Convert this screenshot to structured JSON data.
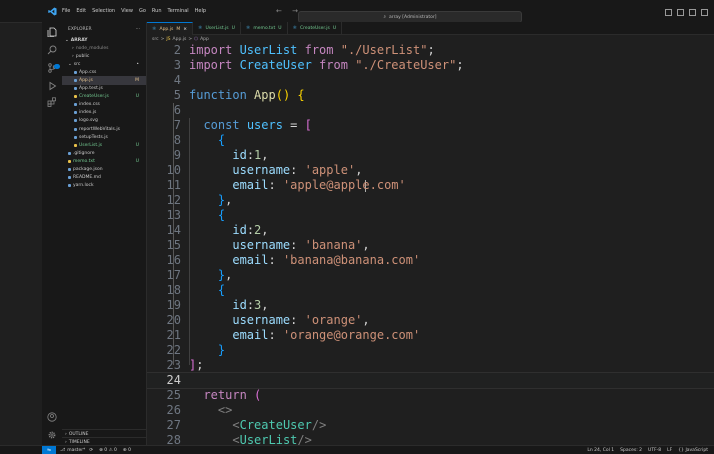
{
  "titlebar": {
    "menu": [
      "File",
      "Edit",
      "Selection",
      "View",
      "Go",
      "Run",
      "Terminal",
      "Help"
    ],
    "nav_arrows": "← →",
    "search_text": "array [Administrator]"
  },
  "explorer": {
    "title": "EXPLORER",
    "more": "···",
    "project": "ARRAY",
    "items": [
      {
        "label": "node_modules",
        "mark": "",
        "color": "#8b8b8b"
      },
      {
        "label": "public",
        "mark": "",
        "color": "#cccccc"
      },
      {
        "label": "src",
        "mark": "•",
        "color": "#cccccc"
      },
      {
        "label": "App.css",
        "mark": "",
        "color": "#cccccc"
      },
      {
        "label": "App.js",
        "mark": "M",
        "color": "#e2c08d"
      },
      {
        "label": "App.test.js",
        "mark": "",
        "color": "#cccccc"
      },
      {
        "label": "CreateUser.js",
        "mark": "U",
        "color": "#73c991"
      },
      {
        "label": "index.css",
        "mark": "",
        "color": "#cccccc"
      },
      {
        "label": "index.js",
        "mark": "",
        "color": "#cccccc"
      },
      {
        "label": "logo.svg",
        "mark": "",
        "color": "#cccccc"
      },
      {
        "label": "reportWebVitals.js",
        "mark": "",
        "color": "#cccccc"
      },
      {
        "label": "setupTests.js",
        "mark": "",
        "color": "#cccccc"
      },
      {
        "label": "UserList.js",
        "mark": "U",
        "color": "#73c991"
      },
      {
        "label": ".gitignore",
        "mark": "",
        "color": "#cccccc"
      },
      {
        "label": "memo.txt",
        "mark": "U",
        "color": "#73c991"
      },
      {
        "label": "package.json",
        "mark": "",
        "color": "#cccccc"
      },
      {
        "label": "README.md",
        "mark": "",
        "color": "#cccccc"
      },
      {
        "label": "yarn.lock",
        "mark": "",
        "color": "#cccccc"
      }
    ],
    "outline": "OUTLINE",
    "timeline": "TIMELINE"
  },
  "tabs": [
    {
      "label": "App.js",
      "mark": "M",
      "active": true,
      "close": "×"
    },
    {
      "label": "UserList.js",
      "mark": "U",
      "active": false
    },
    {
      "label": "memo.txt",
      "mark": "U",
      "active": false
    },
    {
      "label": "CreateUser.js",
      "mark": "U",
      "active": false
    }
  ],
  "breadcrumb": {
    "src": "src",
    "sep": ">",
    "file": "App.js",
    "symbol": "App"
  },
  "code_lines": [
    {
      "n": "2",
      "tokens": [
        [
          "imp",
          "import "
        ],
        [
          "var",
          "UserList"
        ],
        [
          "imp",
          " from "
        ],
        [
          "str",
          "\"./UserList\""
        ],
        [
          "pl",
          ";"
        ]
      ]
    },
    {
      "n": "3",
      "tokens": [
        [
          "imp",
          "import "
        ],
        [
          "var",
          "CreateUser"
        ],
        [
          "imp",
          " from "
        ],
        [
          "str",
          "\"./CreateUser\""
        ],
        [
          "pl",
          ";"
        ]
      ]
    },
    {
      "n": "4",
      "tokens": []
    },
    {
      "n": "5",
      "tokens": [
        [
          "kw",
          "function "
        ],
        [
          "fn",
          "App"
        ],
        [
          "p1",
          "()"
        ],
        [
          "pl",
          " "
        ],
        [
          "p1",
          "{"
        ]
      ]
    },
    {
      "n": "6",
      "tokens": []
    },
    {
      "n": "7",
      "tokens": [
        [
          "pl",
          "  "
        ],
        [
          "kw",
          "const "
        ],
        [
          "var",
          "users"
        ],
        [
          "pl",
          " = "
        ],
        [
          "p2",
          "["
        ]
      ]
    },
    {
      "n": "8",
      "tokens": [
        [
          "pl",
          "    "
        ],
        [
          "p3",
          "{"
        ]
      ]
    },
    {
      "n": "9",
      "tokens": [
        [
          "pl",
          "      "
        ],
        [
          "prop",
          "id"
        ],
        [
          "pl",
          ":"
        ],
        [
          "num",
          "1"
        ],
        [
          "pl",
          ","
        ]
      ]
    },
    {
      "n": "10",
      "tokens": [
        [
          "pl",
          "      "
        ],
        [
          "prop",
          "username"
        ],
        [
          "pl",
          ": "
        ],
        [
          "str",
          "'apple'"
        ],
        [
          "pl",
          ","
        ]
      ]
    },
    {
      "n": "11",
      "tokens": [
        [
          "pl",
          "      "
        ],
        [
          "prop",
          "email"
        ],
        [
          "pl",
          ": "
        ],
        [
          "str",
          "'apple@apple.com'"
        ]
      ]
    },
    {
      "n": "12",
      "tokens": [
        [
          "pl",
          "    "
        ],
        [
          "p3",
          "}"
        ],
        [
          "pl",
          ","
        ]
      ]
    },
    {
      "n": "13",
      "tokens": [
        [
          "pl",
          "    "
        ],
        [
          "p3",
          "{"
        ]
      ]
    },
    {
      "n": "14",
      "tokens": [
        [
          "pl",
          "      "
        ],
        [
          "prop",
          "id"
        ],
        [
          "pl",
          ":"
        ],
        [
          "num",
          "2"
        ],
        [
          "pl",
          ","
        ]
      ]
    },
    {
      "n": "15",
      "tokens": [
        [
          "pl",
          "      "
        ],
        [
          "prop",
          "username"
        ],
        [
          "pl",
          ": "
        ],
        [
          "str",
          "'banana'"
        ],
        [
          "pl",
          ","
        ]
      ]
    },
    {
      "n": "16",
      "tokens": [
        [
          "pl",
          "      "
        ],
        [
          "prop",
          "email"
        ],
        [
          "pl",
          ": "
        ],
        [
          "str",
          "'banana@banana.com'"
        ]
      ]
    },
    {
      "n": "17",
      "tokens": [
        [
          "pl",
          "    "
        ],
        [
          "p3",
          "}"
        ],
        [
          "pl",
          ","
        ]
      ]
    },
    {
      "n": "18",
      "tokens": [
        [
          "pl",
          "    "
        ],
        [
          "p3",
          "{"
        ]
      ]
    },
    {
      "n": "19",
      "tokens": [
        [
          "pl",
          "      "
        ],
        [
          "prop",
          "id"
        ],
        [
          "pl",
          ":"
        ],
        [
          "num",
          "3"
        ],
        [
          "pl",
          ","
        ]
      ]
    },
    {
      "n": "20",
      "tokens": [
        [
          "pl",
          "      "
        ],
        [
          "prop",
          "username"
        ],
        [
          "pl",
          ": "
        ],
        [
          "str",
          "'orange'"
        ],
        [
          "pl",
          ","
        ]
      ]
    },
    {
      "n": "21",
      "tokens": [
        [
          "pl",
          "      "
        ],
        [
          "prop",
          "email"
        ],
        [
          "pl",
          ": "
        ],
        [
          "str",
          "'orange@orange.com'"
        ]
      ]
    },
    {
      "n": "22",
      "tokens": [
        [
          "pl",
          "    "
        ],
        [
          "p3",
          "}"
        ]
      ]
    },
    {
      "n": "23",
      "tokens": [
        [
          "p2",
          "]"
        ],
        [
          "pl",
          ";"
        ]
      ]
    },
    {
      "n": "24",
      "tokens": [],
      "current": true
    },
    {
      "n": "25",
      "tokens": [
        [
          "pl",
          "  "
        ],
        [
          "imp",
          "return "
        ],
        [
          "p2",
          "("
        ]
      ]
    },
    {
      "n": "26",
      "tokens": [
        [
          "pl",
          "    "
        ],
        [
          "br",
          "<>"
        ]
      ]
    },
    {
      "n": "27",
      "tokens": [
        [
          "pl",
          "      "
        ],
        [
          "br",
          "<"
        ],
        [
          "tag",
          "CreateUser"
        ],
        [
          "br",
          "/>"
        ]
      ]
    },
    {
      "n": "28",
      "tokens": [
        [
          "pl",
          "      "
        ],
        [
          "br",
          "<"
        ],
        [
          "tag",
          "UserList"
        ],
        [
          "br",
          "/>"
        ]
      ]
    }
  ],
  "statusbar": {
    "branch": "master*",
    "sync": "⟳",
    "problems": "⊗ 0 ⚠ 0",
    "ports": "⊕ 0",
    "position": "Ln 24, Col 1",
    "spaces": "Spaces: 2",
    "encoding": "UTF-8",
    "eol": "LF",
    "language": "{} JavaScript"
  }
}
